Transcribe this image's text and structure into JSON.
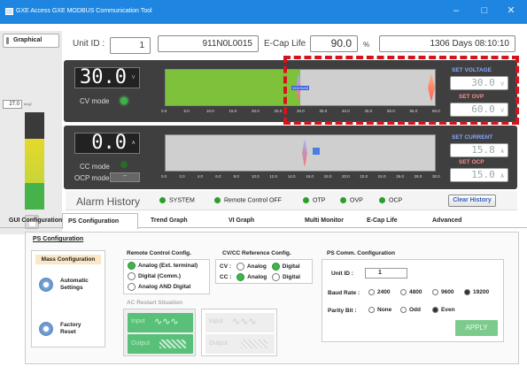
{
  "window": {
    "title": "GXE Access  GXE MODBUS Communication Tool",
    "controls": [
      "–",
      "□",
      "✕"
    ]
  },
  "left_panel": {
    "tab_label": "Graphical",
    "readout_value": "27.0",
    "readout_unit": "degC"
  },
  "header": {
    "unit_id_label": "Unit ID :",
    "unit_id_value": "1",
    "serial": "911N0L0015",
    "ecap_label": "E-Cap Life",
    "ecap_value": "90.0",
    "ecap_unit": "%",
    "days": "1306 Days 08:10:10"
  },
  "voltage_panel": {
    "display": "30.0",
    "unit": "V",
    "mode_label": "CV mode",
    "bar_level": 0.5,
    "ticks": [
      "0.0",
      "5.0",
      "10.0",
      "15.0",
      "20.0",
      "25.0",
      "30.0",
      "35.0",
      "40.0",
      "45.0",
      "50.0",
      "55.0",
      "60.0"
    ],
    "marker_label": "VOLTAGE",
    "set_label": "SET VOLTAGE",
    "set_value": "30.0",
    "set_unit": "V",
    "ovp_label": "SET OVP",
    "ovp_value": "60.0",
    "ovp_unit": "V"
  },
  "current_panel": {
    "display": "0.0",
    "unit": "A",
    "cc_label": "CC mode",
    "ocp_label": "OCP mode",
    "ocp_value": "--",
    "ticks": [
      "0.0",
      "2.0",
      "4.0",
      "6.0",
      "8.0",
      "10.0",
      "12.0",
      "14.0",
      "16.0",
      "18.0",
      "20.0",
      "22.0",
      "24.0",
      "26.0",
      "28.0",
      "30.0"
    ],
    "set_label": "SET CURRENT",
    "set_value": "15.8",
    "set_unit": "A",
    "ocp_set_label": "SET OCP",
    "ocp_set_value": "15.0",
    "ocp_set_unit": "A"
  },
  "alarm": {
    "title": "Alarm History",
    "items": [
      "SYSTEM",
      "Remote Control OFF",
      "OTP",
      "OVP",
      "OCP"
    ],
    "clear_label": "Clear History"
  },
  "tabs": [
    "GUI Configuration",
    "PS Configuration",
    "Trend Graph",
    "VI Graph",
    "Multi Monitor",
    "E-Cap Life",
    "Advanced"
  ],
  "ps_config": {
    "title": "PS Configuration",
    "mass_label": "Mass Configuration",
    "auto_label": "Automatic Settings",
    "factory_label": "Factory Reset",
    "remote_title": "Remote Control Config.",
    "remote_options": [
      "Analog (Ext. terminal)",
      "Digital (Comm.)",
      "Analog AND Digital"
    ],
    "remote_selected": 0,
    "cvcc_title": "CV/CC Reference Config.",
    "cv_label": "CV :",
    "cc_label": "CC :",
    "cvcc_options": [
      "Analog",
      "Digital"
    ],
    "cv_selected": 1,
    "cc_selected": 0,
    "ac_title": "AC Restart Situation",
    "input_label": "Input",
    "output_label": "Output",
    "comm_title": "PS Comm. Configuration",
    "comm_unit_label": "Unit ID :",
    "comm_unit_value": "1",
    "baud_label": "Baud Rate :",
    "baud_options": [
      "2400",
      "4800",
      "9600",
      "19200"
    ],
    "baud_selected": 3,
    "parity_label": "Parity Bit :",
    "parity_options": [
      "None",
      "Odd",
      "Even"
    ],
    "parity_selected": 2,
    "apply_label": "APPLY"
  }
}
